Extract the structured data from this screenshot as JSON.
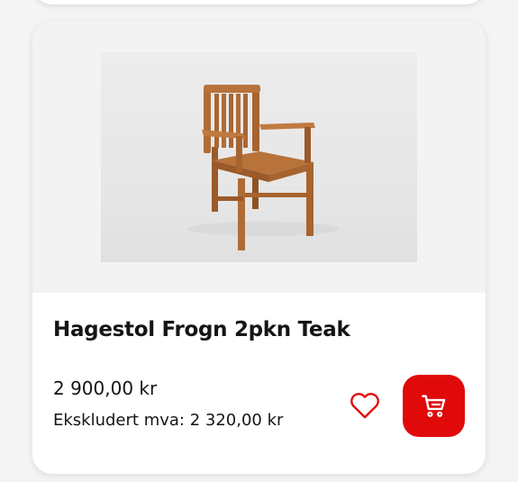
{
  "product": {
    "title": "Hagestol Frogn 2pkn Teak",
    "price": "2 900,00 kr",
    "price_ex_vat": "Ekskludert mva: 2 320,00 kr",
    "image_icon": "teak-garden-chair"
  },
  "actions": {
    "favorite_icon": "heart-icon",
    "cart_icon": "cart-icon"
  },
  "colors": {
    "accent": "#e10a0a",
    "text": "#151515",
    "card_background": "#ffffff",
    "page_background": "#f4f4f4"
  }
}
